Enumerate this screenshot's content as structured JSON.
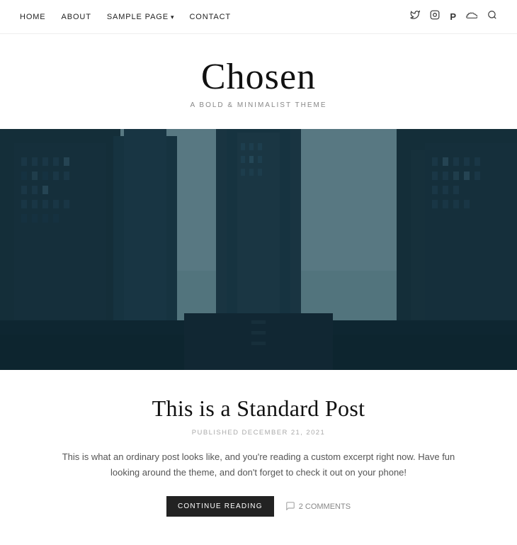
{
  "nav": {
    "links": [
      {
        "label": "HOME",
        "id": "home"
      },
      {
        "label": "ABOUT",
        "id": "about"
      },
      {
        "label": "SAMPLE PAGE",
        "id": "sample-page",
        "has_dropdown": true
      },
      {
        "label": "CONTACT",
        "id": "contact"
      }
    ],
    "social_icons": [
      {
        "name": "twitter-icon",
        "symbol": "𝕏",
        "unicode": "🐦"
      },
      {
        "name": "instagram-icon",
        "symbol": "⬜",
        "unicode": "📷"
      },
      {
        "name": "pinterest-icon",
        "symbol": "P",
        "unicode": "📌"
      },
      {
        "name": "soundcloud-icon",
        "symbol": "☁",
        "unicode": "☁"
      },
      {
        "name": "search-icon",
        "symbol": "🔍",
        "unicode": "🔍"
      }
    ]
  },
  "header": {
    "title": "Chosen",
    "tagline": "A BOLD & MINIMALIST THEME"
  },
  "post": {
    "title": "This is a Standard Post",
    "meta": "PUBLISHED DECEMBER 21, 2021",
    "excerpt": "This is what an ordinary post looks like, and you're reading a custom excerpt right now. Have fun looking around the theme, and don't forget to check it out on your phone!",
    "read_more_label": "CONTINUE READING",
    "comments_label": "2 COMMENTS"
  }
}
